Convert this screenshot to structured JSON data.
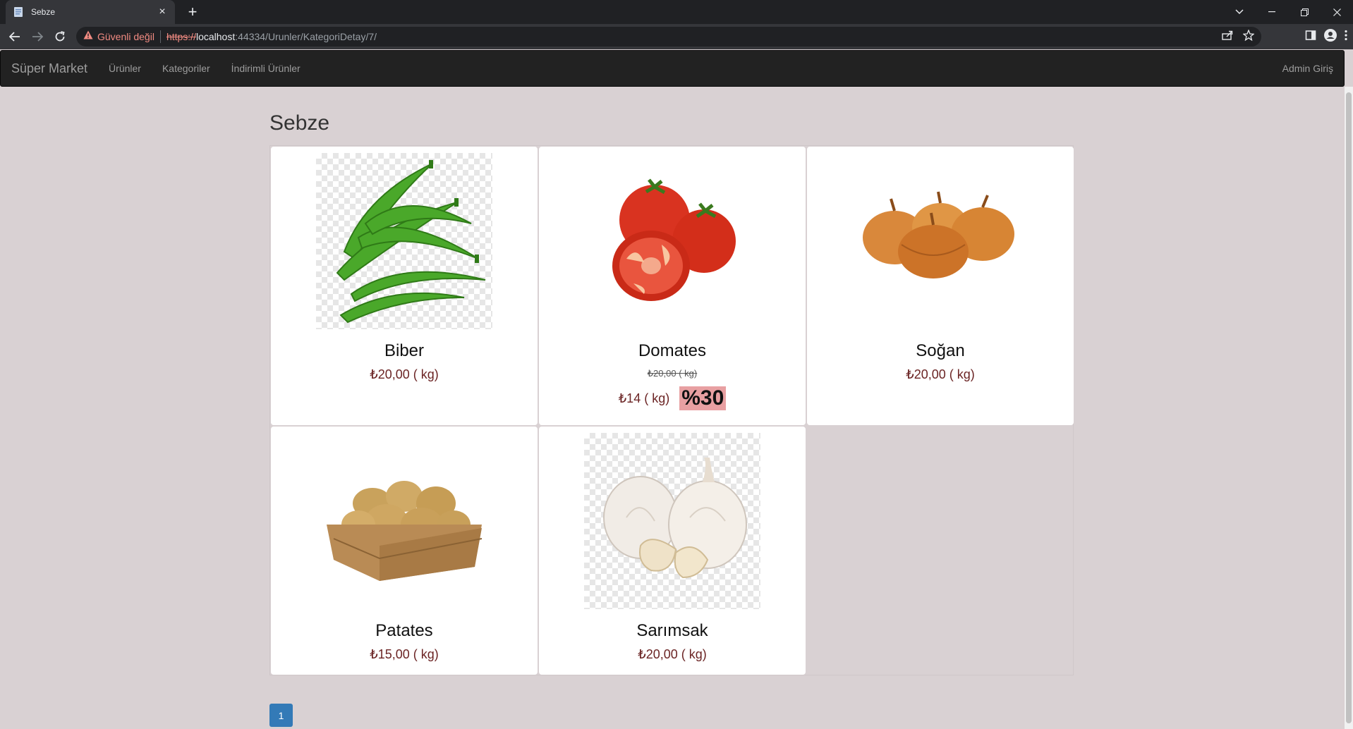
{
  "browser": {
    "tab_title": "Sebze",
    "security_label": "Güvenli değil",
    "url_scheme": "https://",
    "url_host": "localhost",
    "url_path": ":44334/Urunler/KategoriDetay/7/"
  },
  "navbar": {
    "brand": "Süper Market",
    "links": [
      "Ürünler",
      "Kategoriler",
      "İndirimli Ürünler"
    ],
    "admin": "Admin Giriş"
  },
  "page": {
    "title": "Sebze"
  },
  "products": [
    {
      "name": "Biber",
      "price": "₺20,00 ( kg)"
    },
    {
      "name": "Domates",
      "old_price": "₺20,00 ( kg)",
      "new_price": "₺14 ( kg)",
      "discount": "%30"
    },
    {
      "name": "Soğan",
      "price": "₺20,00 ( kg)"
    },
    {
      "name": "Patates",
      "price": "₺15,00 ( kg)"
    },
    {
      "name": "Sarımsak",
      "price": "₺20,00 ( kg)"
    }
  ],
  "pagination": {
    "current": "1"
  },
  "colors": {
    "accent": "#337ab7",
    "price": "#6b2424",
    "discount_badge": "#e8a0a2",
    "navbar": "#222222"
  }
}
